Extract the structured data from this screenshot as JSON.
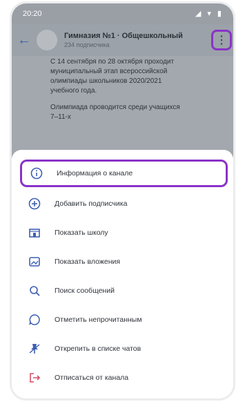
{
  "status_bar": {
    "time": "20:20",
    "icons": "◢ ▾ ▮"
  },
  "header": {
    "title": "Гимназия №1 · Общешкольный",
    "subtitle": "234 подписчика"
  },
  "chat": {
    "paragraphs": [
      "С 14 сентября по 28 октября проходит муниципальный этап всероссийской олимпиады школьников 2020/2021 учебного года.",
      "Олимпиада проводится среди учащихся 7–11-х"
    ]
  },
  "menu": {
    "items": [
      {
        "label": "Информация о канале",
        "icon": "info-icon",
        "highlighted": true
      },
      {
        "label": "Добавить подписчика",
        "icon": "add-icon"
      },
      {
        "label": "Показать школу",
        "icon": "school-icon"
      },
      {
        "label": "Показать вложения",
        "icon": "attachments-icon"
      },
      {
        "label": "Поиск сообщений",
        "icon": "search-icon"
      },
      {
        "label": "Отметить непрочитанным",
        "icon": "unread-icon"
      },
      {
        "label": "Открепить в списке чатов",
        "icon": "unpin-icon"
      },
      {
        "label": "Отписаться от канала",
        "icon": "leave-icon"
      }
    ]
  },
  "colors": {
    "accent": "#3c5fb4",
    "highlight": "#8a32c8",
    "danger": "#d84a63"
  }
}
